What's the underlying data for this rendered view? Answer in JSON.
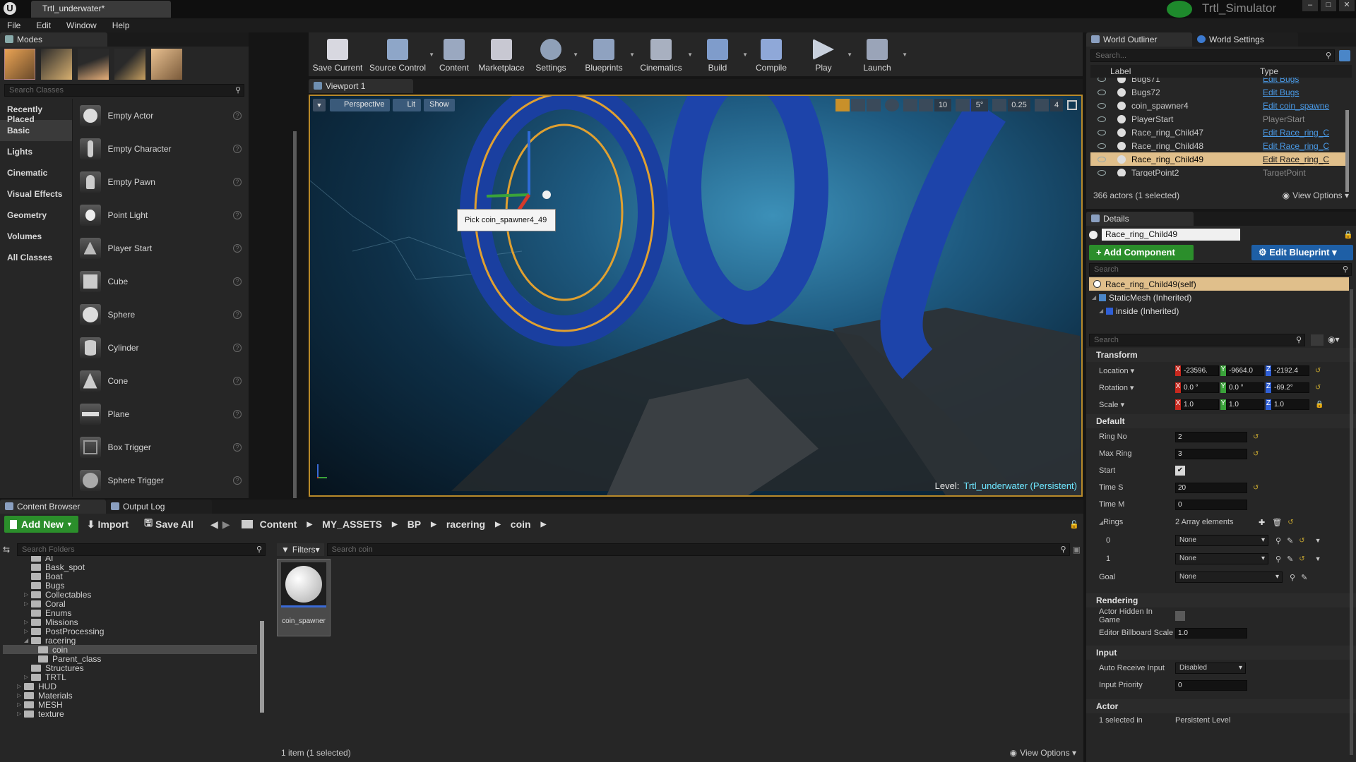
{
  "app": {
    "doc_tab": "Trtl_underwater*",
    "name": "Trtl_Simulator"
  },
  "menu": [
    "File",
    "Edit",
    "Window",
    "Help"
  ],
  "modes": {
    "tab": "Modes",
    "search_placeholder": "Search Classes",
    "categories": [
      "Recently Placed",
      "Basic",
      "Lights",
      "Cinematic",
      "Visual Effects",
      "Geometry",
      "Volumes",
      "All Classes"
    ],
    "items": [
      "Empty Actor",
      "Empty Character",
      "Empty Pawn",
      "Point Light",
      "Player Start",
      "Cube",
      "Sphere",
      "Cylinder",
      "Cone",
      "Plane",
      "Box Trigger",
      "Sphere Trigger"
    ]
  },
  "toolbar": [
    {
      "label": "Save Current",
      "color": "#d8d8e0"
    },
    {
      "label": "Source Control",
      "color": "#8ea6c8"
    },
    {
      "label": "Content",
      "color": "#9aa8c0"
    },
    {
      "label": "Marketplace",
      "color": "#c8c8d2"
    },
    {
      "label": "Settings",
      "color": "#8fa0b8"
    },
    {
      "label": "Blueprints",
      "color": "#8fa2c0"
    },
    {
      "label": "Cinematics",
      "color": "#a8b0c0"
    },
    {
      "label": "Build",
      "color": "#7f9ccb"
    },
    {
      "label": "Compile",
      "color": "#8fa8d8"
    },
    {
      "label": "Play",
      "color": "#c8d0dc"
    },
    {
      "label": "Launch",
      "color": "#9aa4b8"
    }
  ],
  "viewport": {
    "tab": "Viewport 1",
    "perspective": "Perspective",
    "lit": "Lit",
    "show": "Show",
    "grid": "10",
    "angle": "5°",
    "scale": "0.25",
    "cam": "4",
    "tooltip": "Pick coin_spawner4_49",
    "level_label": "Level:",
    "level_name": "Trtl_underwater (Persistent)"
  },
  "outliner": {
    "tab1": "World Outliner",
    "tab2": "World Settings",
    "search": "Search...",
    "col_label": "Label",
    "col_type": "Type",
    "rows": [
      {
        "label": "Bugs71",
        "type": "Edit Bugs",
        "link": true
      },
      {
        "label": "Bugs72",
        "type": "Edit Bugs",
        "link": true
      },
      {
        "label": "coin_spawner4",
        "type": "Edit coin_spawne",
        "link": true
      },
      {
        "label": "PlayerStart",
        "type": "PlayerStart",
        "link": false
      },
      {
        "label": "Race_ring_Child47",
        "type": "Edit Race_ring_C",
        "link": true
      },
      {
        "label": "Race_ring_Child48",
        "type": "Edit Race_ring_C",
        "link": true
      },
      {
        "label": "Race_ring_Child49",
        "type": "Edit Race_ring_C",
        "link": true,
        "selected": true
      },
      {
        "label": "TargetPoint2",
        "type": "TargetPoint",
        "link": false
      }
    ],
    "count": "366 actors (1 selected)",
    "view_options": "View Options"
  },
  "details": {
    "tab": "Details",
    "name": "Race_ring_Child49",
    "add_component": "+ Add Component",
    "edit_blueprint": "Edit Blueprint",
    "search": "Search",
    "components": [
      "Race_ring_Child49(self)",
      "StaticMesh (Inherited)",
      "inside (Inherited)"
    ],
    "transform": {
      "title": "Transform",
      "location_label": "Location",
      "rotation_label": "Rotation",
      "scale_label": "Scale",
      "location": [
        "-23596.",
        "-9664.0",
        "-2192.4"
      ],
      "rotation": [
        "0.0 °",
        "0.0 °",
        "-69.2°"
      ],
      "scale": [
        "1.0",
        "1.0",
        "1.0"
      ]
    },
    "default": {
      "title": "Default",
      "ring_no_label": "Ring No",
      "ring_no": "2",
      "max_ring_label": "Max Ring",
      "max_ring": "3",
      "start_label": "Start",
      "time_s_label": "Time S",
      "time_s": "20",
      "time_m_label": "Time M",
      "time_m": "0",
      "rings_label": "Rings",
      "rings_count": "2 Array elements",
      "ring_index": [
        "0",
        "1"
      ],
      "none": "None",
      "goal_label": "Goal"
    },
    "rendering": {
      "title": "Rendering",
      "hidden_label": "Actor Hidden In Game",
      "billboard_label": "Editor Billboard Scale",
      "billboard": "1.0"
    },
    "input": {
      "title": "Input",
      "auto_label": "Auto Receive Input",
      "auto": "Disabled",
      "priority_label": "Input Priority",
      "priority": "0"
    },
    "actor": {
      "title": "Actor",
      "selected_label": "1 selected in",
      "selected_value": "Persistent Level"
    }
  },
  "content": {
    "tab1": "Content Browser",
    "tab2": "Output Log",
    "add_new": "Add New",
    "import": "Import",
    "save_all": "Save All",
    "breadcrumb": [
      "Content",
      "MY_ASSETS",
      "BP",
      "racering",
      "coin"
    ],
    "search_folders": "Search Folders",
    "filters": "Filters",
    "search_assets": "Search coin",
    "folders": [
      {
        "name": "AI",
        "indent": 1,
        "tri": false
      },
      {
        "name": "Bask_spot",
        "indent": 1,
        "tri": false
      },
      {
        "name": "Boat",
        "indent": 1,
        "tri": false
      },
      {
        "name": "Bugs",
        "indent": 1,
        "tri": false
      },
      {
        "name": "Collectables",
        "indent": 1,
        "tri": true
      },
      {
        "name": "Coral",
        "indent": 1,
        "tri": true
      },
      {
        "name": "Enums",
        "indent": 1,
        "tri": false
      },
      {
        "name": "Missions",
        "indent": 1,
        "tri": true
      },
      {
        "name": "PostProcessing",
        "indent": 1,
        "tri": true
      },
      {
        "name": "racering",
        "indent": 1,
        "tri": true,
        "open": true
      },
      {
        "name": "coin",
        "indent": 2,
        "tri": false,
        "selected": true
      },
      {
        "name": "Parent_class",
        "indent": 2,
        "tri": false
      },
      {
        "name": "Structures",
        "indent": 1,
        "tri": false
      },
      {
        "name": "TRTL",
        "indent": 1,
        "tri": true
      },
      {
        "name": "HUD",
        "indent": 0,
        "tri": true
      },
      {
        "name": "Materials",
        "indent": 0,
        "tri": true
      },
      {
        "name": "MESH",
        "indent": 0,
        "tri": true
      },
      {
        "name": "texture",
        "indent": 0,
        "tri": true
      }
    ],
    "asset": "coin_spawner",
    "status": "1 item (1 selected)",
    "view_options": "View Options"
  }
}
